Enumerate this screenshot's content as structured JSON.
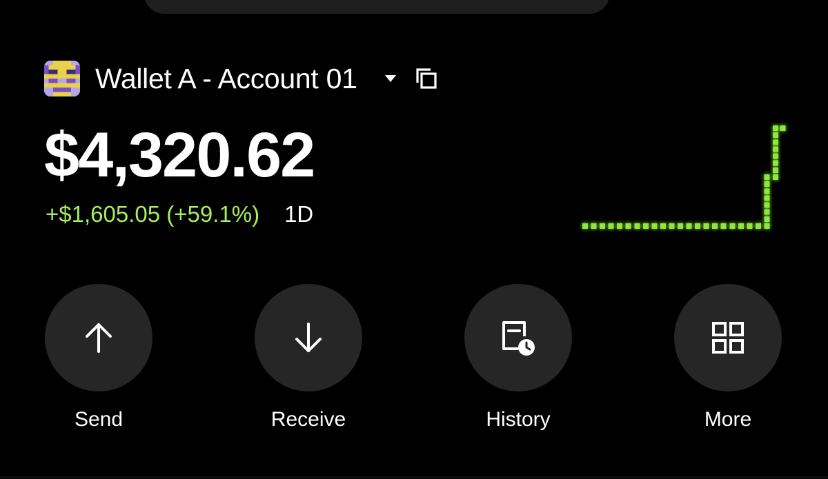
{
  "wallet": {
    "name": "Wallet A - Account 01",
    "avatar_icon": "pixel-avatar-icon"
  },
  "balance": {
    "amount": "$4,320.62",
    "change": "+$1,605.05 (+59.1%)",
    "change_color": "#a6f05a",
    "period": "1D"
  },
  "chart_data": {
    "type": "line",
    "style": "pixel-dotted",
    "color": "#8ee83a",
    "title": "",
    "xlabel": "",
    "ylabel": "",
    "grid": false,
    "legend": "none",
    "x": [
      0,
      1,
      2,
      3,
      4,
      5,
      6,
      7,
      8,
      9,
      10,
      11,
      12,
      13,
      14,
      15,
      16,
      17,
      18,
      19,
      20,
      21,
      22
    ],
    "values": [
      0,
      0,
      0,
      0,
      0,
      0,
      0,
      0,
      0,
      0,
      0,
      0,
      0,
      0,
      0,
      0,
      0,
      0,
      0,
      0,
      0,
      0.5,
      1
    ],
    "ylim": [
      0,
      1
    ]
  },
  "actions": [
    {
      "label": "Send",
      "icon": "arrow-up-icon"
    },
    {
      "label": "Receive",
      "icon": "arrow-down-icon"
    },
    {
      "label": "History",
      "icon": "history-clock-icon"
    },
    {
      "label": "More",
      "icon": "grid-icon"
    }
  ],
  "colors": {
    "background": "#000000",
    "button_bg": "#262626",
    "accent_green": "#a6f05a"
  }
}
